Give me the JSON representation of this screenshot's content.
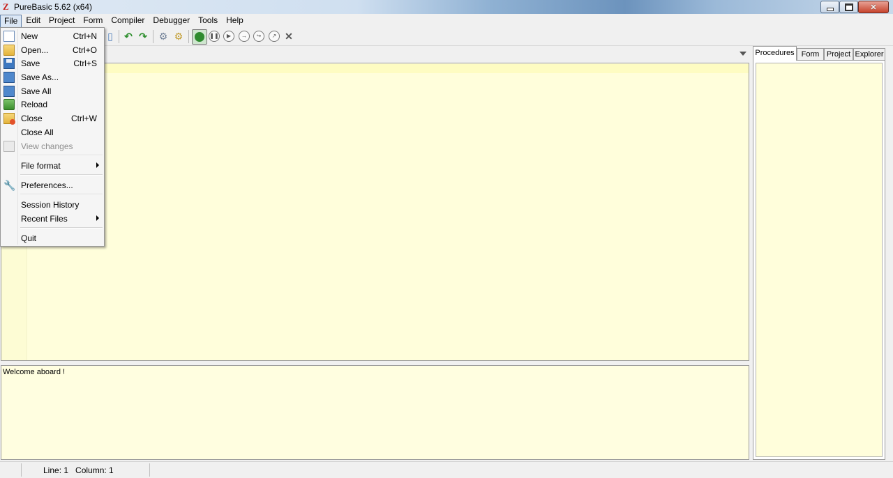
{
  "window": {
    "title": "PureBasic 5.62 (x64)"
  },
  "menubar": [
    {
      "label": "File"
    },
    {
      "label": "Edit"
    },
    {
      "label": "Project"
    },
    {
      "label": "Form"
    },
    {
      "label": "Compiler"
    },
    {
      "label": "Debugger"
    },
    {
      "label": "Tools"
    },
    {
      "label": "Help"
    }
  ],
  "file_menu": {
    "items": [
      {
        "label": "New",
        "shortcut": "Ctrl+N",
        "icon": "new-file-icon"
      },
      {
        "label": "Open...",
        "shortcut": "Ctrl+O",
        "icon": "open-folder-icon"
      },
      {
        "label": "Save",
        "shortcut": "Ctrl+S",
        "icon": "save-disk-icon"
      },
      {
        "label": "Save As...",
        "icon": "save-as-icon"
      },
      {
        "label": "Save All",
        "icon": "save-all-icon"
      },
      {
        "label": "Reload",
        "icon": "reload-icon"
      },
      {
        "label": "Close",
        "shortcut": "Ctrl+W",
        "icon": "close-file-icon"
      },
      {
        "label": "Close All"
      },
      {
        "label": "View changes",
        "disabled": true,
        "icon": "view-changes-icon"
      },
      {
        "label": "File format",
        "submenu": true
      },
      {
        "label": "Preferences...",
        "icon": "wrench-icon"
      },
      {
        "label": "Session History"
      },
      {
        "label": "Recent Files",
        "submenu": true
      },
      {
        "label": "Quit"
      }
    ]
  },
  "output": {
    "message": "Welcome aboard !"
  },
  "side_panel": {
    "tabs": [
      {
        "label": "Procedures",
        "active": true
      },
      {
        "label": "Form"
      },
      {
        "label": "Project"
      },
      {
        "label": "Explorer"
      }
    ]
  },
  "statusbar": {
    "position": "Line: 1   Column: 1"
  },
  "colors": {
    "editor_bg": "#fffedb",
    "menu_highlight": "#dbe7f5"
  }
}
